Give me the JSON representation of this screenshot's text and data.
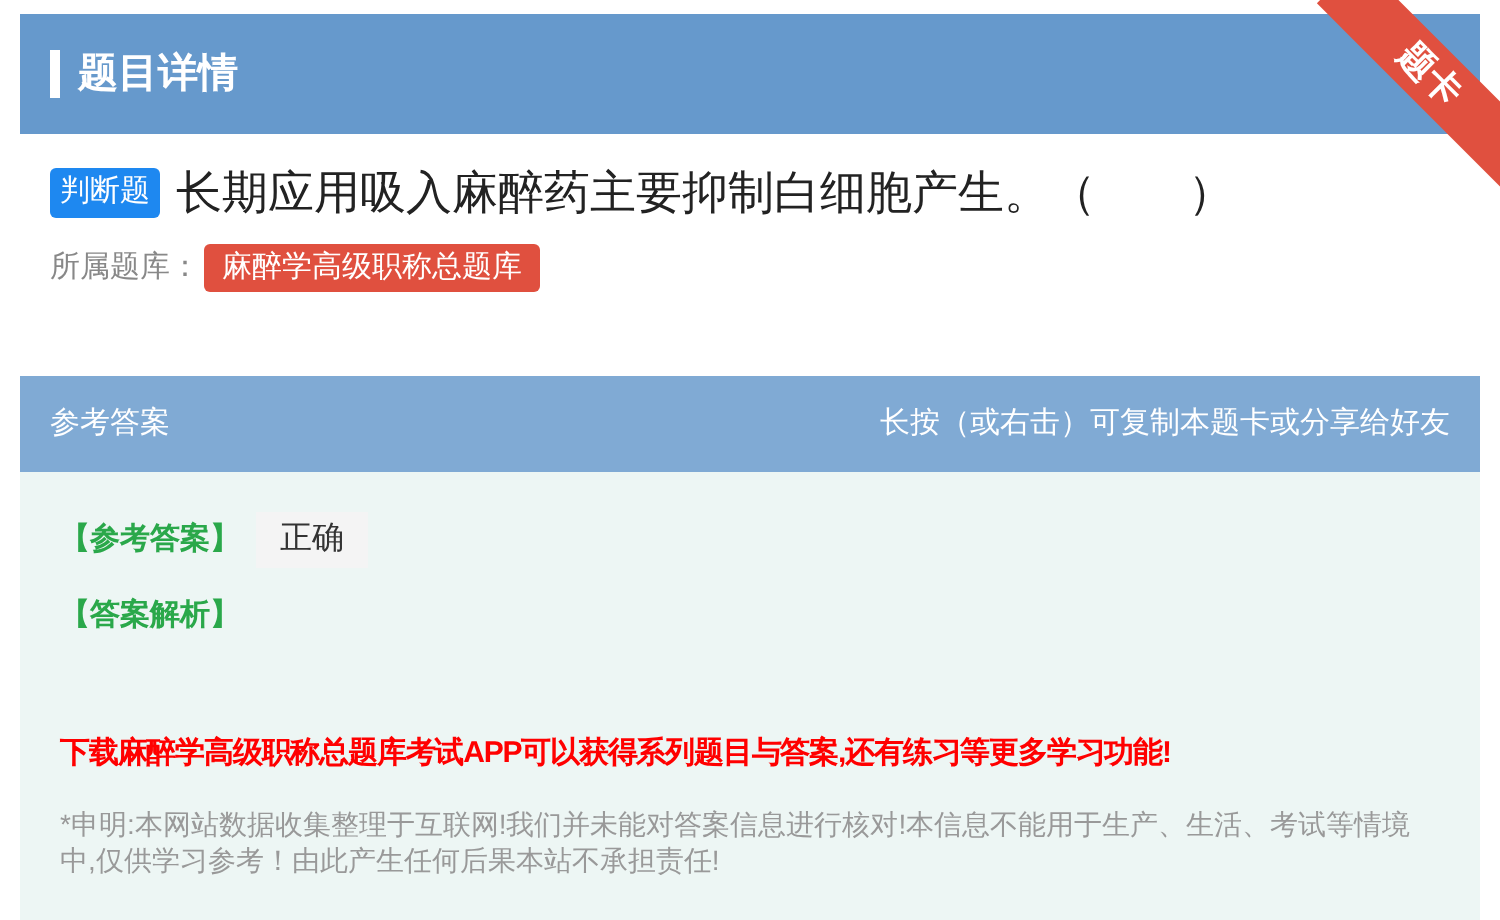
{
  "header": {
    "title": "题目详情",
    "ribbon": "题卡"
  },
  "question": {
    "type_badge": "判断题",
    "text": "长期应用吸入麻醉药主要抑制白细胞产生。（　　）",
    "bank_label": "所属题库：",
    "bank": "麻醉学高级职称总题库"
  },
  "answer_card": {
    "title": "参考答案",
    "hint": "长按（或右击）可复制本题卡或分享给好友",
    "answer_label": "【参考答案】",
    "answer": "正确",
    "analysis_label": "【答案解析】",
    "promo": "下载麻醉学高级职称总题库考试APP可以获得系列题目与答案,还有练习等更多学习功能!",
    "disclaimer": "*申明:本网站数据收集整理于互联网!我们并未能对答案信息进行核对!本信息不能用于生产、生活、考试等情境中,仅供学习参考！由此产生任何后果本站不承担责任!"
  }
}
